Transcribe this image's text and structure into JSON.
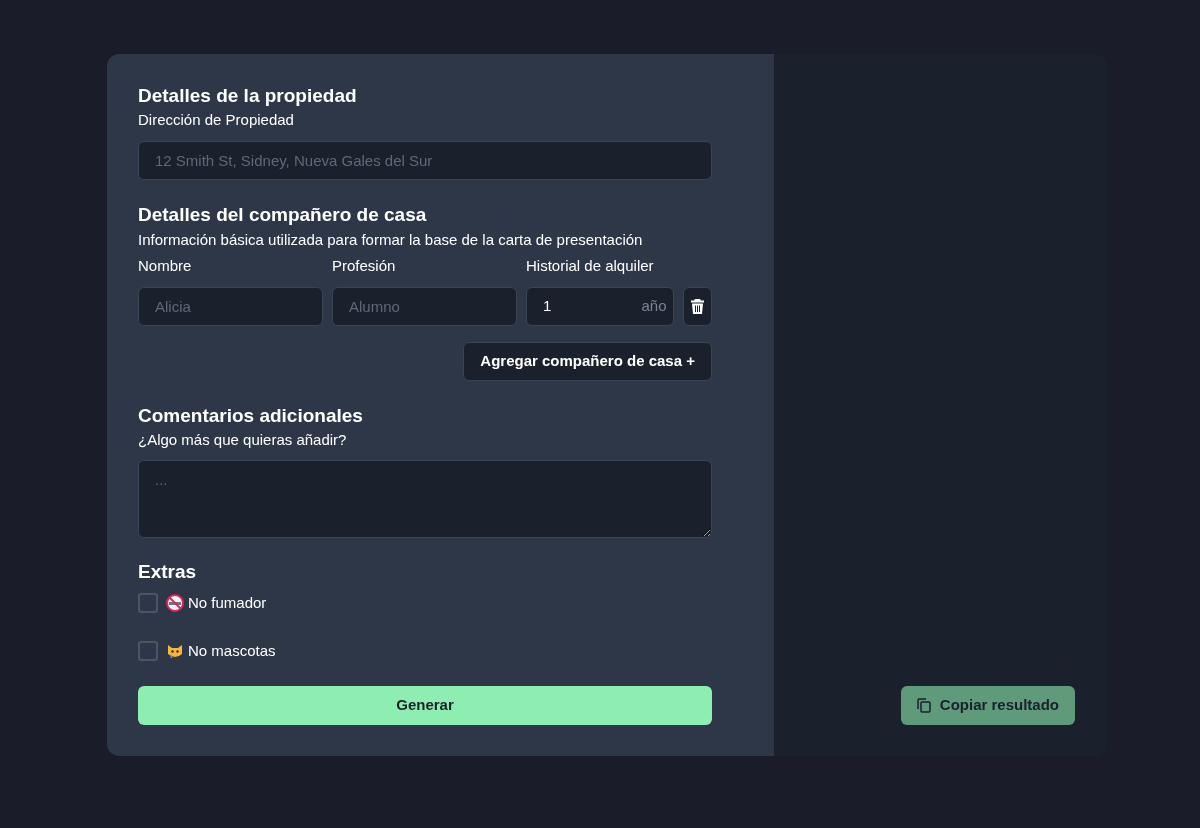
{
  "property": {
    "title": "Detalles de la propiedad",
    "address_label": "Dirección de Propiedad",
    "address_placeholder": "12 Smith St, Sidney, Nueva Gales del Sur"
  },
  "housemates": {
    "title": "Detalles del compañero de casa",
    "subtitle": "Información básica utilizada para formar la base de la carta de presentación",
    "columns": [
      "Nombre",
      "Profesión",
      "Historial de alquiler"
    ],
    "rows": [
      {
        "name_placeholder": "Alicia",
        "profession_placeholder": "Alumno",
        "rental_value": "1",
        "rental_unit": "año"
      }
    ],
    "add_button": "Agregar compañero de casa +"
  },
  "comments": {
    "title": "Comentarios adicionales",
    "label": "¿Algo más que quieras añadir?",
    "placeholder": "..."
  },
  "extras": {
    "title": "Extras",
    "options": [
      {
        "kind": "no-smoking",
        "label": "No fumador",
        "checked": false
      },
      {
        "kind": "no-pets",
        "label": "No mascotas",
        "checked": false
      }
    ]
  },
  "generate_button": "Generar",
  "copy_button": {
    "label": "Copiar resultado",
    "disabled": true
  }
}
